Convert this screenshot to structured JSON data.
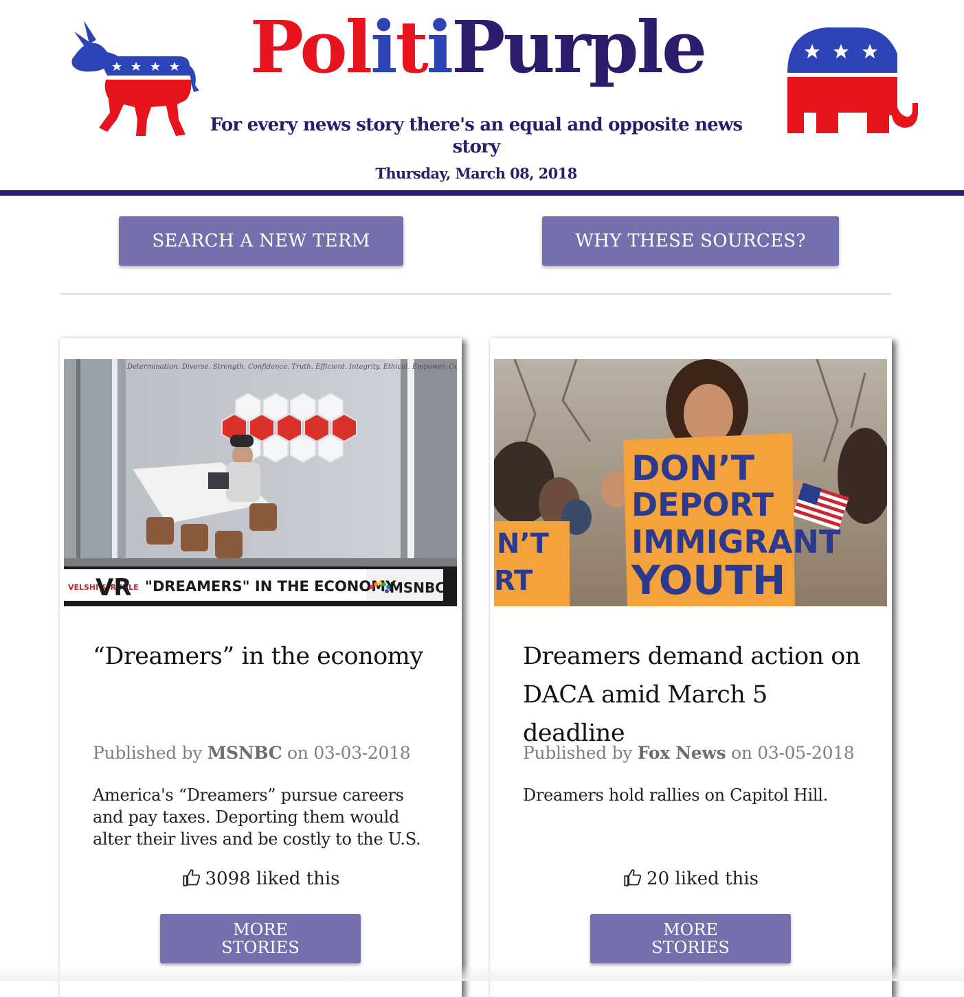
{
  "header": {
    "title_parts": [
      "Pol",
      "i",
      "t",
      "i",
      "Purple"
    ],
    "tagline": "For every news story there's an equal and opposite news story",
    "date": "Thursday, March 08, 2018"
  },
  "actions": {
    "search_label": "SEARCH A NEW TERM",
    "sources_label": "WHY THESE SOURCES?"
  },
  "cards": [
    {
      "image_caption": "\"DREAMERS\" IN THE ECONOMY",
      "image_network": "MSNBC",
      "image_show": "VELSHI & RUHLE",
      "image_wall_text": "Determination. Diverse. Strength. Confidence. Truth. Efficient. Integrity. Ethical. Empower. Commitment. Compassion. Consistent. Energy",
      "title": "“Dreamers” in the economy",
      "published_prefix": "Published by",
      "source": "MSNBC",
      "published_on": "on 03-03-2018",
      "summary": "America's “Dreamers” pursue careers and pay taxes. Deporting them would alter their lives and be costly to the U.S.",
      "likes": "3098 liked this",
      "more_label": "MORE STORIES"
    },
    {
      "image_sign_lines": [
        "DON’T",
        "DEPORT",
        "IMMIGRANT",
        "YOUTH"
      ],
      "image_side_sign": [
        "N’T",
        "RT"
      ],
      "title": "Dreamers demand action on DACA amid March 5 deadline",
      "published_prefix": "Published by",
      "source": "Fox News",
      "published_on": "on 03-05-2018",
      "summary": "Dreamers hold rallies on Capitol Hill.",
      "likes": "20 liked this",
      "more_label": "MORE STORIES"
    }
  ],
  "colors": {
    "brand_red": "#e8141d",
    "brand_blue": "#2c44b5",
    "brand_purple": "#2d1b6b",
    "button": "#7370ad",
    "sign_orange": "#f3a23c"
  },
  "icons": [
    "democrat-donkey-icon",
    "republican-elephant-icon",
    "thumbs-up-icon"
  ]
}
